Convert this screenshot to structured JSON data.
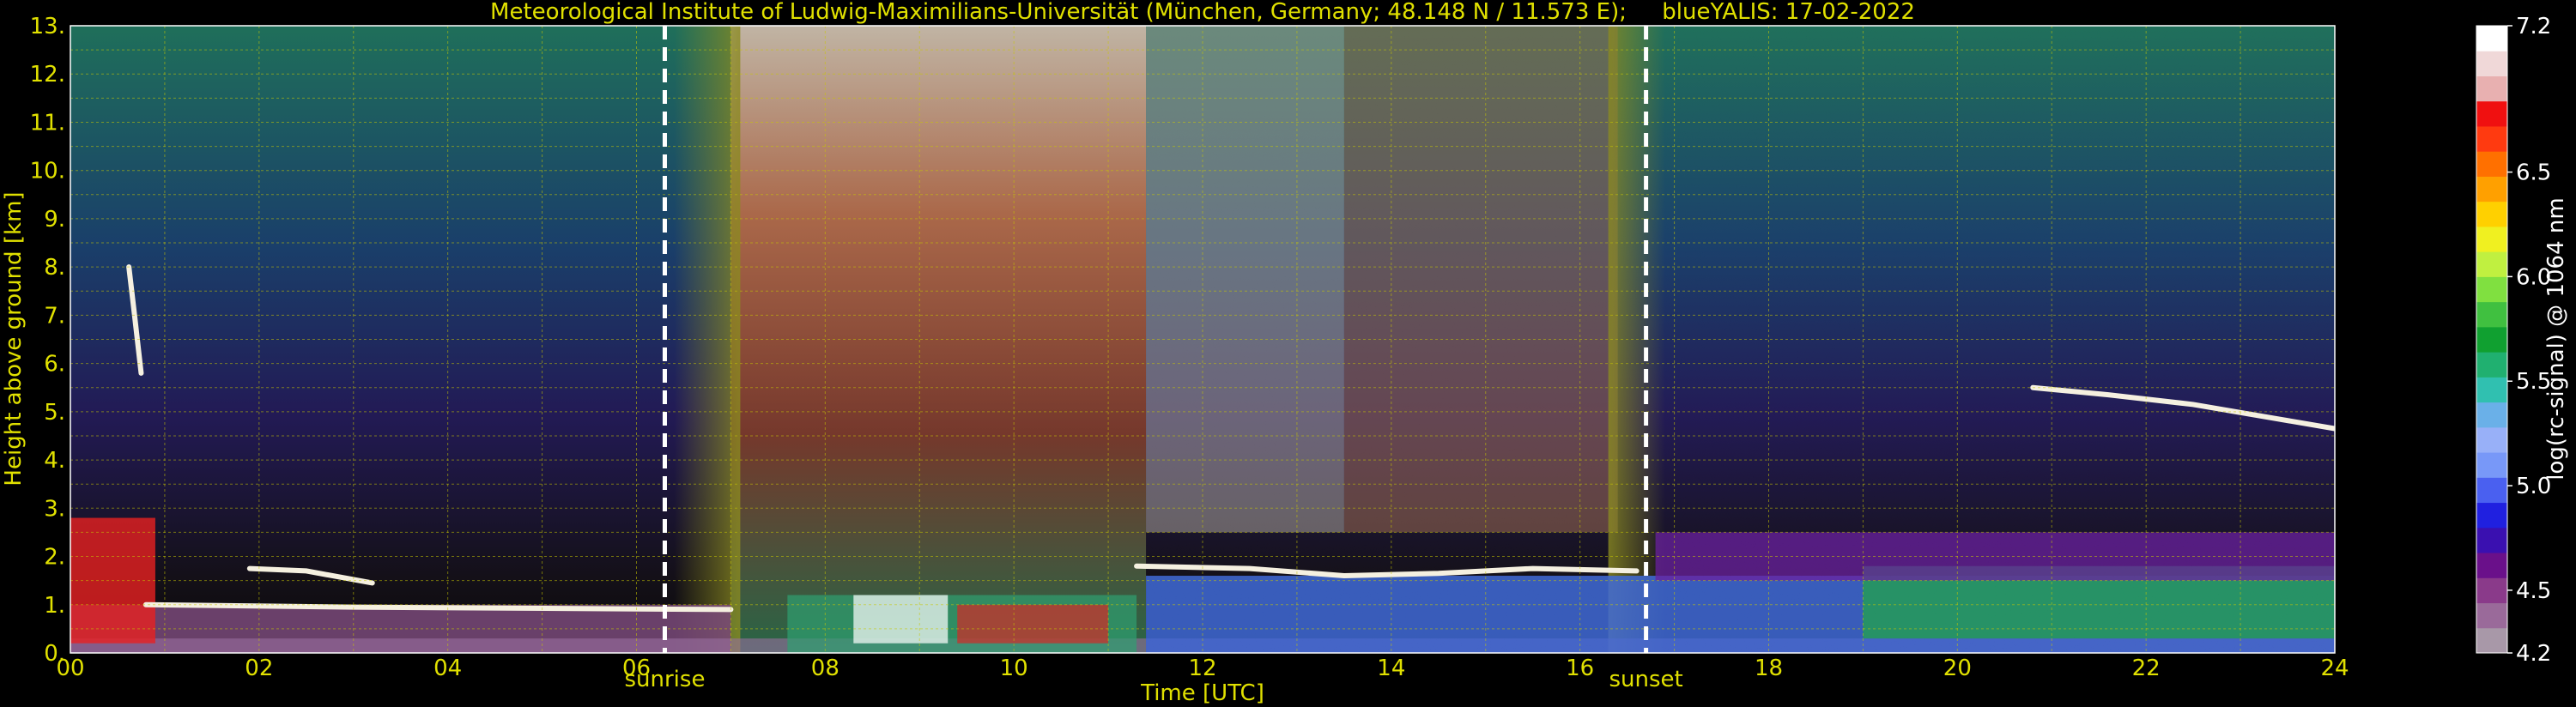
{
  "chart_data": {
    "type": "heatmap",
    "title": "Meteorological Institute of Ludwig-Maximilians-Universität (München, Germany; 48.148 N / 11.573 E);     blueYALIS: 17-02-2022",
    "xlabel": "Time [UTC]",
    "ylabel": "Height above ground [km]",
    "xlim": [
      0,
      24
    ],
    "ylim": [
      0,
      13
    ],
    "x_ticks": [
      "00",
      "02",
      "04",
      "06",
      "08",
      "10",
      "12",
      "14",
      "16",
      "18",
      "20",
      "22",
      "24"
    ],
    "y_ticks": [
      "0.",
      "1.",
      "2.",
      "3.",
      "4.",
      "5.",
      "6.",
      "7.",
      "8.",
      "9.",
      "10.",
      "11.",
      "12.",
      "13."
    ],
    "grid": true,
    "colorbar": {
      "label": "log(rc-signal) @ 1064 nm",
      "range": [
        4.2,
        7.2
      ],
      "tick_labels": [
        "7.2",
        "6.5",
        "6.0",
        "5.5",
        "5.0",
        "4.5",
        "4.2"
      ],
      "tick_values": [
        7.2,
        6.5,
        6.0,
        5.5,
        5.0,
        4.5,
        4.2
      ]
    },
    "markers": [
      {
        "label": "sunrise",
        "time": 6.3
      },
      {
        "label": "sunset",
        "time": 16.7
      }
    ]
  }
}
